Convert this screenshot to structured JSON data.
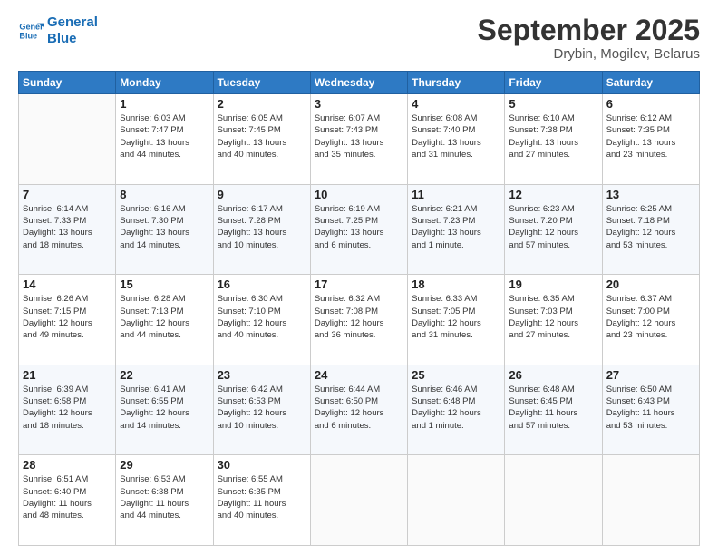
{
  "logo": {
    "line1": "General",
    "line2": "Blue"
  },
  "title": "September 2025",
  "location": "Drybin, Mogilev, Belarus",
  "days_of_week": [
    "Sunday",
    "Monday",
    "Tuesday",
    "Wednesday",
    "Thursday",
    "Friday",
    "Saturday"
  ],
  "weeks": [
    [
      {
        "day": "",
        "info": ""
      },
      {
        "day": "1",
        "info": "Sunrise: 6:03 AM\nSunset: 7:47 PM\nDaylight: 13 hours\nand 44 minutes."
      },
      {
        "day": "2",
        "info": "Sunrise: 6:05 AM\nSunset: 7:45 PM\nDaylight: 13 hours\nand 40 minutes."
      },
      {
        "day": "3",
        "info": "Sunrise: 6:07 AM\nSunset: 7:43 PM\nDaylight: 13 hours\nand 35 minutes."
      },
      {
        "day": "4",
        "info": "Sunrise: 6:08 AM\nSunset: 7:40 PM\nDaylight: 13 hours\nand 31 minutes."
      },
      {
        "day": "5",
        "info": "Sunrise: 6:10 AM\nSunset: 7:38 PM\nDaylight: 13 hours\nand 27 minutes."
      },
      {
        "day": "6",
        "info": "Sunrise: 6:12 AM\nSunset: 7:35 PM\nDaylight: 13 hours\nand 23 minutes."
      }
    ],
    [
      {
        "day": "7",
        "info": "Sunrise: 6:14 AM\nSunset: 7:33 PM\nDaylight: 13 hours\nand 18 minutes."
      },
      {
        "day": "8",
        "info": "Sunrise: 6:16 AM\nSunset: 7:30 PM\nDaylight: 13 hours\nand 14 minutes."
      },
      {
        "day": "9",
        "info": "Sunrise: 6:17 AM\nSunset: 7:28 PM\nDaylight: 13 hours\nand 10 minutes."
      },
      {
        "day": "10",
        "info": "Sunrise: 6:19 AM\nSunset: 7:25 PM\nDaylight: 13 hours\nand 6 minutes."
      },
      {
        "day": "11",
        "info": "Sunrise: 6:21 AM\nSunset: 7:23 PM\nDaylight: 13 hours\nand 1 minute."
      },
      {
        "day": "12",
        "info": "Sunrise: 6:23 AM\nSunset: 7:20 PM\nDaylight: 12 hours\nand 57 minutes."
      },
      {
        "day": "13",
        "info": "Sunrise: 6:25 AM\nSunset: 7:18 PM\nDaylight: 12 hours\nand 53 minutes."
      }
    ],
    [
      {
        "day": "14",
        "info": "Sunrise: 6:26 AM\nSunset: 7:15 PM\nDaylight: 12 hours\nand 49 minutes."
      },
      {
        "day": "15",
        "info": "Sunrise: 6:28 AM\nSunset: 7:13 PM\nDaylight: 12 hours\nand 44 minutes."
      },
      {
        "day": "16",
        "info": "Sunrise: 6:30 AM\nSunset: 7:10 PM\nDaylight: 12 hours\nand 40 minutes."
      },
      {
        "day": "17",
        "info": "Sunrise: 6:32 AM\nSunset: 7:08 PM\nDaylight: 12 hours\nand 36 minutes."
      },
      {
        "day": "18",
        "info": "Sunrise: 6:33 AM\nSunset: 7:05 PM\nDaylight: 12 hours\nand 31 minutes."
      },
      {
        "day": "19",
        "info": "Sunrise: 6:35 AM\nSunset: 7:03 PM\nDaylight: 12 hours\nand 27 minutes."
      },
      {
        "day": "20",
        "info": "Sunrise: 6:37 AM\nSunset: 7:00 PM\nDaylight: 12 hours\nand 23 minutes."
      }
    ],
    [
      {
        "day": "21",
        "info": "Sunrise: 6:39 AM\nSunset: 6:58 PM\nDaylight: 12 hours\nand 18 minutes."
      },
      {
        "day": "22",
        "info": "Sunrise: 6:41 AM\nSunset: 6:55 PM\nDaylight: 12 hours\nand 14 minutes."
      },
      {
        "day": "23",
        "info": "Sunrise: 6:42 AM\nSunset: 6:53 PM\nDaylight: 12 hours\nand 10 minutes."
      },
      {
        "day": "24",
        "info": "Sunrise: 6:44 AM\nSunset: 6:50 PM\nDaylight: 12 hours\nand 6 minutes."
      },
      {
        "day": "25",
        "info": "Sunrise: 6:46 AM\nSunset: 6:48 PM\nDaylight: 12 hours\nand 1 minute."
      },
      {
        "day": "26",
        "info": "Sunrise: 6:48 AM\nSunset: 6:45 PM\nDaylight: 11 hours\nand 57 minutes."
      },
      {
        "day": "27",
        "info": "Sunrise: 6:50 AM\nSunset: 6:43 PM\nDaylight: 11 hours\nand 53 minutes."
      }
    ],
    [
      {
        "day": "28",
        "info": "Sunrise: 6:51 AM\nSunset: 6:40 PM\nDaylight: 11 hours\nand 48 minutes."
      },
      {
        "day": "29",
        "info": "Sunrise: 6:53 AM\nSunset: 6:38 PM\nDaylight: 11 hours\nand 44 minutes."
      },
      {
        "day": "30",
        "info": "Sunrise: 6:55 AM\nSunset: 6:35 PM\nDaylight: 11 hours\nand 40 minutes."
      },
      {
        "day": "",
        "info": ""
      },
      {
        "day": "",
        "info": ""
      },
      {
        "day": "",
        "info": ""
      },
      {
        "day": "",
        "info": ""
      }
    ]
  ]
}
